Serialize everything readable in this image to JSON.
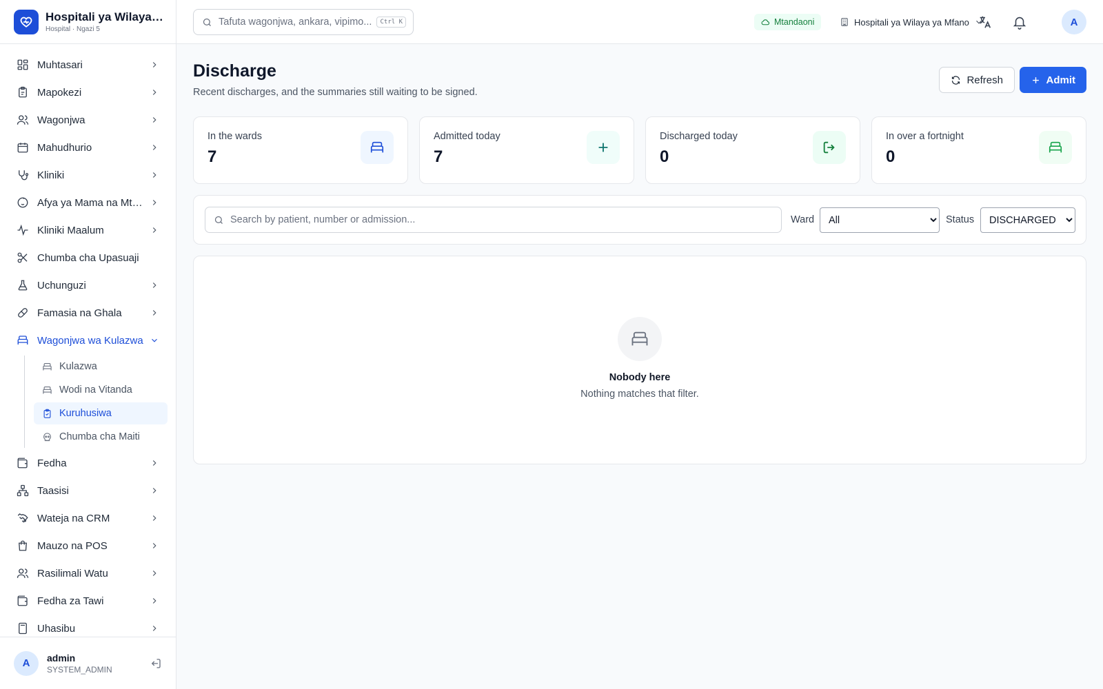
{
  "brand": {
    "title": "Hospitali ya Wilaya ya Mfano",
    "subtitle": "Hospital · Ngazi 5",
    "accent": "#1d4ed8"
  },
  "header": {
    "search_placeholder": "Tafuta wagonjwa, ankara, vipimo...",
    "shortcut": "Ctrl K",
    "status": "Mtandaoni",
    "organization": "Hospitali ya Wilaya ya Mfano",
    "avatar_initial": "A"
  },
  "sidebar": {
    "items": [
      {
        "label": "Muhtasari",
        "icon": "dashboard-icon"
      },
      {
        "label": "Mapokezi",
        "icon": "clipboard-icon"
      },
      {
        "label": "Wagonjwa",
        "icon": "users-icon"
      },
      {
        "label": "Mahudhurio",
        "icon": "calendar-icon"
      },
      {
        "label": "Kliniki",
        "icon": "stethoscope-icon"
      },
      {
        "label": "Afya ya Mama na Mtoto",
        "icon": "baby-icon"
      },
      {
        "label": "Kliniki Maalum",
        "icon": "activity-icon"
      },
      {
        "label": "Chumba cha Upasuaji",
        "icon": "scissors-icon"
      },
      {
        "label": "Uchunguzi",
        "icon": "flask-icon"
      },
      {
        "label": "Famasia na Ghala",
        "icon": "pill-icon"
      },
      {
        "label": "Wagonjwa wa Kulazwa",
        "icon": "bed-icon"
      }
    ],
    "subitems": [
      {
        "label": "Kulazwa",
        "icon": "bed-icon"
      },
      {
        "label": "Wodi na Vitanda",
        "icon": "bed-icon"
      },
      {
        "label": "Kuruhusiwa",
        "icon": "clipboard-check-icon"
      },
      {
        "label": "Chumba cha Maiti",
        "icon": "skull-icon"
      }
    ],
    "items_after": [
      {
        "label": "Fedha",
        "icon": "wallet-icon"
      },
      {
        "label": "Taasisi",
        "icon": "network-icon"
      },
      {
        "label": "Wateja na CRM",
        "icon": "handshake-icon"
      },
      {
        "label": "Mauzo na POS",
        "icon": "shopping-bag-icon"
      },
      {
        "label": "Rasilimali Watu",
        "icon": "users-icon"
      },
      {
        "label": "Fedha za Tawi",
        "icon": "wallet-icon"
      },
      {
        "label": "Uhasibu",
        "icon": "calculator-icon"
      }
    ]
  },
  "user": {
    "initial": "A",
    "name": "admin",
    "role": "SYSTEM_ADMIN"
  },
  "page": {
    "title": "Discharge",
    "subtitle": "Recent discharges, and the summaries still waiting to be signed.",
    "refresh_label": "Refresh",
    "admit_label": "Admit"
  },
  "stats": [
    {
      "label": "In the wards",
      "value": "7",
      "icon": "bed-icon"
    },
    {
      "label": "Admitted today",
      "value": "7",
      "icon": "plus-icon"
    },
    {
      "label": "Discharged today",
      "value": "0",
      "icon": "log-out-icon"
    },
    {
      "label": "In over a fortnight",
      "value": "0",
      "icon": "bed-icon"
    }
  ],
  "filters": {
    "search_placeholder": "Search by patient, number or admission...",
    "ward_label": "Ward",
    "ward_value": "All",
    "status_label": "Status",
    "status_value": "DISCHARGED"
  },
  "empty": {
    "title": "Nobody here",
    "text": "Nothing matches that filter."
  }
}
